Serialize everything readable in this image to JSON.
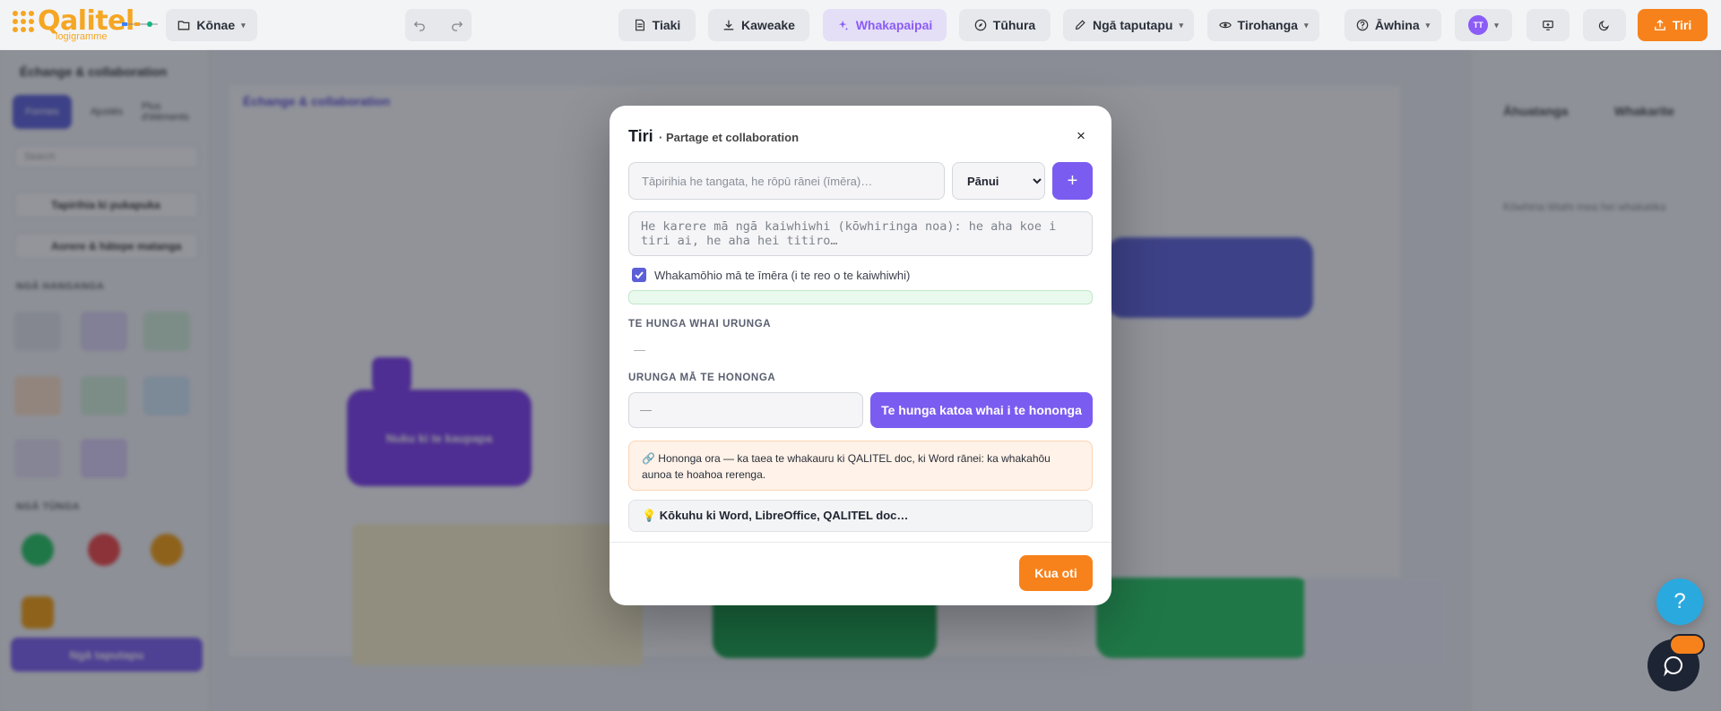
{
  "topbar": {
    "logo_text": "Qalitel",
    "logo_subtext": "logigramme",
    "konae_label": "Kōnae",
    "tiaki_label": "Tiaki",
    "kaweake_label": "Kaweake",
    "whakapaipai_label": "Whakapaipai",
    "tuhura_label": "Tūhura",
    "taputapu_label": "Ngā taputapu",
    "tirohanga_label": "Tirohanga",
    "awhina_label": "Āwhina",
    "avatar_initials": "TT",
    "tiri_label": "Tiri",
    "accent_color": "#8b5cf6",
    "orange_color": "#f7821b"
  },
  "background": {
    "sidebar_title": "Échange & collaboration",
    "sidebar_tabs": [
      "Formes",
      "Ajustés",
      "Plus d'éléments"
    ],
    "search_placeholder": "Search",
    "library_row": "Tapirihia ki pukapuka",
    "group_row": "Aorere & hātepe matanga",
    "section_shapes": "NGĀ HANGANGA",
    "section_status": "NGĀ TŪNGA",
    "cta_label": "Ngā taputapu",
    "canvas_label": "Échange & collaboration",
    "node_label": "Nuku ki te kaupapa",
    "right_tabs": [
      "Āhuatanga",
      "Whakarite"
    ],
    "right_hint": "Kōwhiria tētahi mea hei whakatika"
  },
  "modal": {
    "title": "Tiri",
    "subtitle": "· Partage et collaboration",
    "close_glyph": "×",
    "share_placeholder": "Tāpirihia he tangata, he rōpū rānei (īmēra)…",
    "permission_selected": "Pānui",
    "permission_options": [
      "Pānui"
    ],
    "add_glyph": "+",
    "message_placeholder": "He karere mā ngā kaiwhiwhi (kōwhiringa noa): he aha koe i tiri ai, he aha hei titiro…",
    "notify_label": "Whakamōhio mā te īmēra (i te reo o te kaiwhiwhi)",
    "notify_checked": true,
    "access_section": "TE HUNGA WHAI URUNGA",
    "access_empty": "—",
    "link_section": "URUNGA MĀ TE HONONGA",
    "link_value": "—",
    "link_button": "Te hunga katoa whai i te hononga",
    "info_text": "🔗 Hononga ora — ka taea te whakauru ki QALITEL doc, ki Word rānei: ka whakahōu aunoa te hoahoa rerenga.",
    "tip_text": "💡 Kōkuhu ki Word, LibreOffice, QALITEL doc…",
    "done_label": "Kua oti"
  },
  "floating": {
    "help_glyph": "?"
  }
}
